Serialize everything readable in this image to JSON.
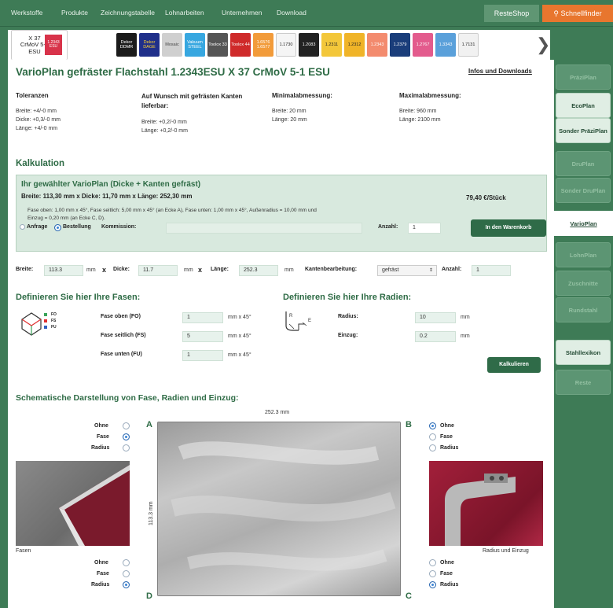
{
  "nav": {
    "links": [
      "Werkstoffe",
      "Produkte",
      "Zeichnungstabelle",
      "Lohnarbeiten",
      "Unternehmen",
      "Download"
    ],
    "reste_label": "ResteShop",
    "schnell_label": "Schnellfinder"
  },
  "tabs": {
    "active_label": "X 37 CrMoV 5-1 ESU",
    "active_mini": "1.2343 ESU",
    "items": [
      {
        "label": "Dekor DDMR",
        "bg": "#1b1b1b",
        "fg": "#ffffff"
      },
      {
        "label": "Dekor DAGE",
        "bg": "#1f2f8a",
        "fg": "#ffd22e"
      },
      {
        "label": "Mosaic",
        "bg": "#cfcfcf",
        "fg": "#444444"
      },
      {
        "label": "Vakuum STEEL",
        "bg": "#37a7e0",
        "fg": "#ffffff"
      },
      {
        "label": "Toolox 33",
        "bg": "#555555",
        "fg": "#ffffff"
      },
      {
        "label": "Toolox 44",
        "bg": "#cf2a2a",
        "fg": "#ffffff"
      },
      {
        "label": "1.6576 1.6577",
        "bg": "#f29b3a",
        "fg": "#ffffff"
      },
      {
        "label": "1.1730",
        "bg": "#f5f5f5",
        "fg": "#222222"
      },
      {
        "label": "1.2083",
        "bg": "#222222",
        "fg": "#ffffff"
      },
      {
        "label": "1.2311",
        "bg": "#f3c73a",
        "fg": "#222222"
      },
      {
        "label": "1.2312",
        "bg": "#f0b428",
        "fg": "#222222"
      },
      {
        "label": "1.2343",
        "bg": "#f38b6e",
        "fg": "#ffffff"
      },
      {
        "label": "1.2379",
        "bg": "#1a3d7a",
        "fg": "#ffffff"
      },
      {
        "label": "1.2767",
        "bg": "#e35b8d",
        "fg": "#ffffff"
      },
      {
        "label": "1.3343",
        "bg": "#5aa0da",
        "fg": "#ffffff"
      },
      {
        "label": "1.7131",
        "bg": "#f1f1f1",
        "fg": "#222222"
      }
    ]
  },
  "sidebar": {
    "items": [
      {
        "label": "PräziPlan",
        "state": "dim"
      },
      {
        "label": "EcoPlan",
        "state": "light"
      },
      {
        "label": "Sonder PräziPlan",
        "state": "light"
      },
      {
        "label": "DruPlan",
        "state": "dim"
      },
      {
        "label": "Sonder DruPlan",
        "state": "dim"
      },
      {
        "label": "VarioPlan",
        "state": "active"
      },
      {
        "label": "LohnPlan",
        "state": "dim"
      },
      {
        "label": "Zuschnitte",
        "state": "dim"
      },
      {
        "label": "Rundstahl",
        "state": "dim"
      },
      {
        "label": "Stahllexikon",
        "state": "light"
      },
      {
        "label": "Reste",
        "state": "dim"
      }
    ]
  },
  "product": {
    "title": "VarioPlan gefräster Flachstahl 1.2343ESU X 37 CrMoV 5-1 ESU",
    "info_link": "Infos und Downloads",
    "toleranzen": {
      "heading": "Toleranzen",
      "lines": [
        "Breite: +4/-0 mm",
        "Dicke: +0,3/-0 mm",
        "Länge: +4/-0 mm"
      ]
    },
    "kanten": {
      "heading": "Auf Wunsch mit gefrästen Kanten lieferbar:",
      "lines": [
        "Breite: +0,2/-0 mm",
        "Länge: +0,2/-0 mm"
      ]
    },
    "min": {
      "heading": "Minimalabmessung:",
      "lines": [
        "Breite: 20 mm",
        "Länge: 20 mm"
      ]
    },
    "max": {
      "heading": "Maximalabmessung:",
      "lines": [
        "Breite: 960 mm",
        "Länge: 2100 mm"
      ]
    }
  },
  "kalkulation": {
    "heading": "Kalkulation",
    "box_title": "Ihr gewählter VarioPlan (Dicke + Kanten gefräst)",
    "dims": "Breite: 113,30 mm x Dicke: 11,70 mm x Länge: 252,30 mm",
    "price": "79,40 €/Stück",
    "details_line1": "Fase oben: 1,00 mm x 45°, Fase seitlich: 5,00 mm x 45° (an Ecke A), Fase unten: 1,00 mm x 45°, Außenradius = 10,00 mm und",
    "details_line2": "Einzug = 0,20 mm (an Ecke C, D).",
    "radio_anfrage": "Anfrage",
    "radio_bestellung": "Bestellung",
    "kommission_label": "Kommission:",
    "anzahl_label": "Anzahl:",
    "anzahl_value": "1",
    "cart_button": "In den Warenkorb"
  },
  "dims_row": {
    "breite_label": "Breite:",
    "breite_value": "113.3",
    "breite_unit": "mm",
    "x1": "x",
    "dicke_label": "Dicke:",
    "dicke_value": "11.7",
    "dicke_unit": "mm",
    "x2": "x",
    "laenge_label": "Länge:",
    "laenge_value": "252.3",
    "laenge_unit": "mm",
    "kanten_label": "Kantenbearbeitung:",
    "kanten_value": "gefräst",
    "anzahl_label": "Anzahl:",
    "anzahl_value": "1"
  },
  "fasen": {
    "heading": "Definieren Sie hier Ihre Fasen:",
    "legend": [
      "FO",
      "FS",
      "FU"
    ],
    "rows": [
      {
        "label": "Fase oben (FO)",
        "value": "1",
        "unit": "mm x 45°"
      },
      {
        "label": "Fase seitlich (FS)",
        "value": "5",
        "unit": "mm x 45°"
      },
      {
        "label": "Fase unten (FU)",
        "value": "1",
        "unit": "mm x 45°"
      }
    ]
  },
  "radien": {
    "heading": "Definieren Sie hier Ihre Radien:",
    "icon_r": "R",
    "icon_e": "E",
    "rows": [
      {
        "label": "Radius:",
        "value": "10",
        "unit": "mm"
      },
      {
        "label": "Einzug:",
        "value": "0.2",
        "unit": "mm"
      }
    ],
    "calc_button": "Kalkulieren"
  },
  "schema": {
    "heading": "Schematische Darstellung von Fase, Radien und Einzug:",
    "top_dim": "252.3 mm",
    "side_dim": "113.3 mm",
    "corners": {
      "a": "A",
      "b": "B",
      "c": "C",
      "d": "D"
    },
    "options": [
      "Ohne",
      "Fase",
      "Radius"
    ],
    "left_caption": "Fasen",
    "right_caption": "Radius und Einzug",
    "selected": {
      "a": "Fase",
      "b": "Ohne",
      "c": "Radius",
      "d": "Radius"
    }
  }
}
